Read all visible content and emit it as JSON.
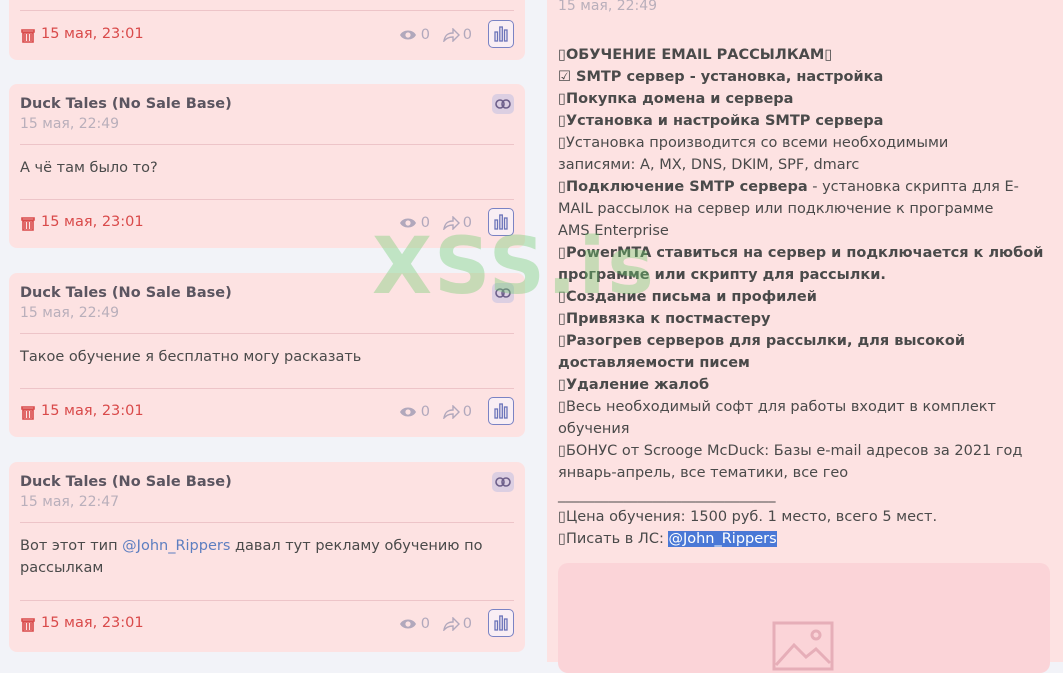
{
  "cards": [
    {
      "author": "",
      "date": "",
      "text": "",
      "footer": {
        "date": "15 мая, 23:01",
        "views": "0",
        "shares": "0"
      }
    },
    {
      "author": "Duck Tales (No Sale Base)",
      "date": "15 мая, 22:49",
      "text": "А чё там было то?",
      "footer": {
        "date": "15 мая, 23:01",
        "views": "0",
        "shares": "0"
      }
    },
    {
      "author": "Duck Tales (No Sale Base)",
      "date": "15 мая, 22:49",
      "text": "Такое обучение я бесплатно могу расказать",
      "footer": {
        "date": "15 мая, 23:01",
        "views": "0",
        "shares": "0"
      }
    },
    {
      "author": "Duck Tales (No Sale Base)",
      "date": "15 мая, 22:47",
      "text_before": "Вот этот тип",
      "mention": "@John_Rippers",
      "text_after": "давал тут рекламу обучению по рассылкам",
      "footer": {
        "date": "15 мая, 23:01",
        "views": "0",
        "shares": "0"
      }
    }
  ],
  "right_post": {
    "date": "15 мая, 22:49",
    "lines": [
      {
        "text": "ОБУЧЕНИЕ EMAIL РАССЫЛКАМ",
        "bold": true
      },
      {
        "text": "☑ SMTP сервер - установка, настройка",
        "bold": true
      },
      {
        "text": "Покупка домена и сервера",
        "bold": true
      },
      {
        "text": "Установка и настройка SMTP сервера",
        "bold": true
      },
      {
        "text": "Установка производится со всеми необходимыми",
        "bold": false
      },
      {
        "text": "записями: A, MX, DNS, DKIM, SPF, dmarc",
        "bold": false
      },
      {
        "bold_part": "Подключение SMTP сервера",
        "rest": " - установка скрипта для E-"
      },
      {
        "text": "MAIL рассылок на сервер или подключение к программе",
        "bold": false
      },
      {
        "text": "AMS Enterprise",
        "bold": false
      },
      {
        "text": "PowerMTA ставиться на сервер и подключается к любой",
        "bold": true
      },
      {
        "text": "программе или скрипту для рассылки.",
        "bold": true
      },
      {
        "text": "Создание письма и профилей",
        "bold": true
      },
      {
        "text": "Привязка к постмастеру",
        "bold": true
      },
      {
        "text": "Разогрев серверов для рассылки, для высокой",
        "bold": true
      },
      {
        "text": "доставляемости писем",
        "bold": true
      },
      {
        "text": "Удаление жалоб",
        "bold": true
      },
      {
        "text": "Весь необходимый софт для работы входит в комплект",
        "bold": false
      },
      {
        "text": "обучения",
        "bold": false
      },
      {
        "text": "БОНУС от Scrooge McDuck: Базы e-mail адресов за 2021 год",
        "bold": false
      },
      {
        "text": "январь-апрель, все тематики, все гео",
        "bold": false
      },
      {
        "text": "______________________________",
        "bold": false
      },
      {
        "text": "Цена обучения: 1500 руб. 1 место, всего 5 мест.",
        "bold": false
      },
      {
        "text": "Писать в ЛС: ",
        "bold": false,
        "mention": "@John_Rippers"
      }
    ]
  },
  "watermark": "XSS.is",
  "colors": {
    "card_bg": "#fde2e2",
    "footer_date": "#d94a4a",
    "mention": "#5d7ec0",
    "highlight": "#4a78d6"
  }
}
